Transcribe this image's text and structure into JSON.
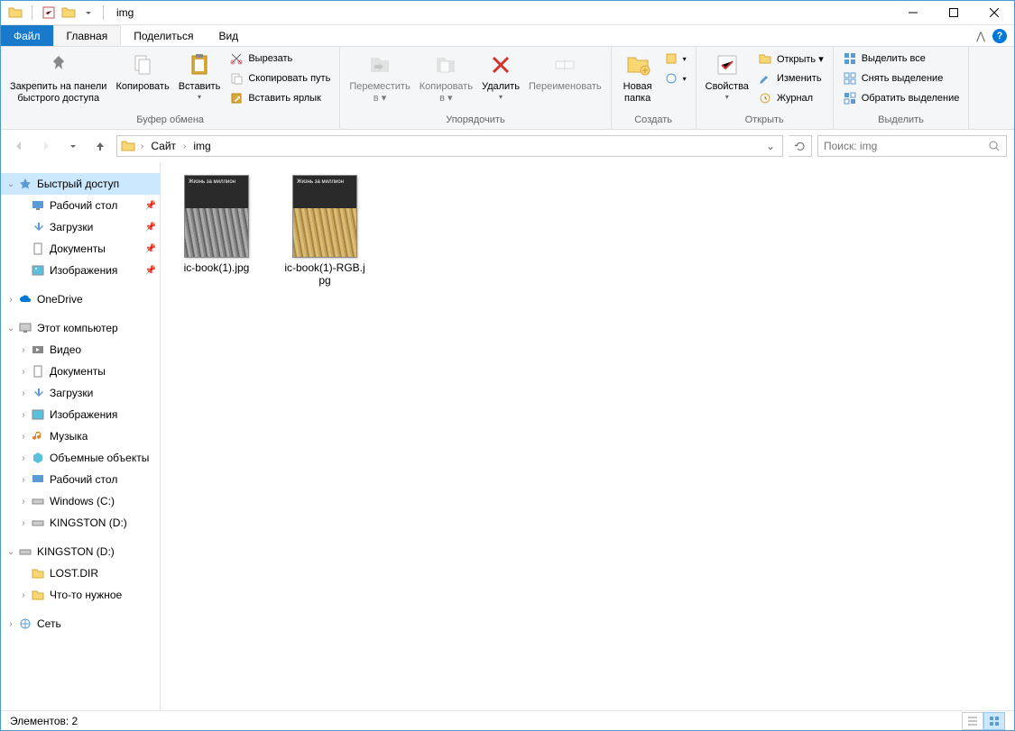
{
  "window": {
    "title": "img"
  },
  "tabs": {
    "file": "Файл",
    "home": "Главная",
    "share": "Поделиться",
    "view": "Вид"
  },
  "ribbon": {
    "clipboard": {
      "label": "Буфер обмена",
      "pin": "Закрепить на панели\nбыстрого доступа",
      "copy": "Копировать",
      "paste": "Вставить",
      "cut": "Вырезать",
      "copy_path": "Скопировать путь",
      "paste_shortcut": "Вставить ярлык"
    },
    "organize": {
      "label": "Упорядочить",
      "move_to": "Переместить\nв ▾",
      "copy_to": "Копировать\nв ▾",
      "delete": "Удалить",
      "rename": "Переименовать"
    },
    "new": {
      "label": "Создать",
      "new_folder": "Новая\nпапка"
    },
    "open": {
      "label": "Открыть",
      "properties": "Свойства",
      "open": "Открыть ▾",
      "edit": "Изменить",
      "history": "Журнал"
    },
    "select": {
      "label": "Выделить",
      "select_all": "Выделить все",
      "select_none": "Снять выделение",
      "invert": "Обратить выделение"
    }
  },
  "breadcrumb": {
    "root": "Сайт",
    "current": "img"
  },
  "search": {
    "placeholder": "Поиск: img"
  },
  "nav": {
    "quick_access": "Быстрый доступ",
    "desktop": "Рабочий стол",
    "downloads": "Загрузки",
    "documents": "Документы",
    "pictures": "Изображения",
    "onedrive": "OneDrive",
    "this_pc": "Этот компьютер",
    "videos": "Видео",
    "documents2": "Документы",
    "downloads2": "Загрузки",
    "pictures2": "Изображения",
    "music": "Музыка",
    "objects3d": "Объемные объекты",
    "desktop2": "Рабочий стол",
    "windows_c": "Windows (C:)",
    "kingston_d": "KINGSTON (D:)",
    "kingston_d2": "KINGSTON (D:)",
    "lost_dir": "LOST.DIR",
    "something": "Что-то нужное",
    "network": "Сеть"
  },
  "files": [
    {
      "name": "ic-book(1).jpg"
    },
    {
      "name": "ic-book(1)-RGB.jpg"
    }
  ],
  "status": {
    "items_label": "Элементов: 2"
  }
}
